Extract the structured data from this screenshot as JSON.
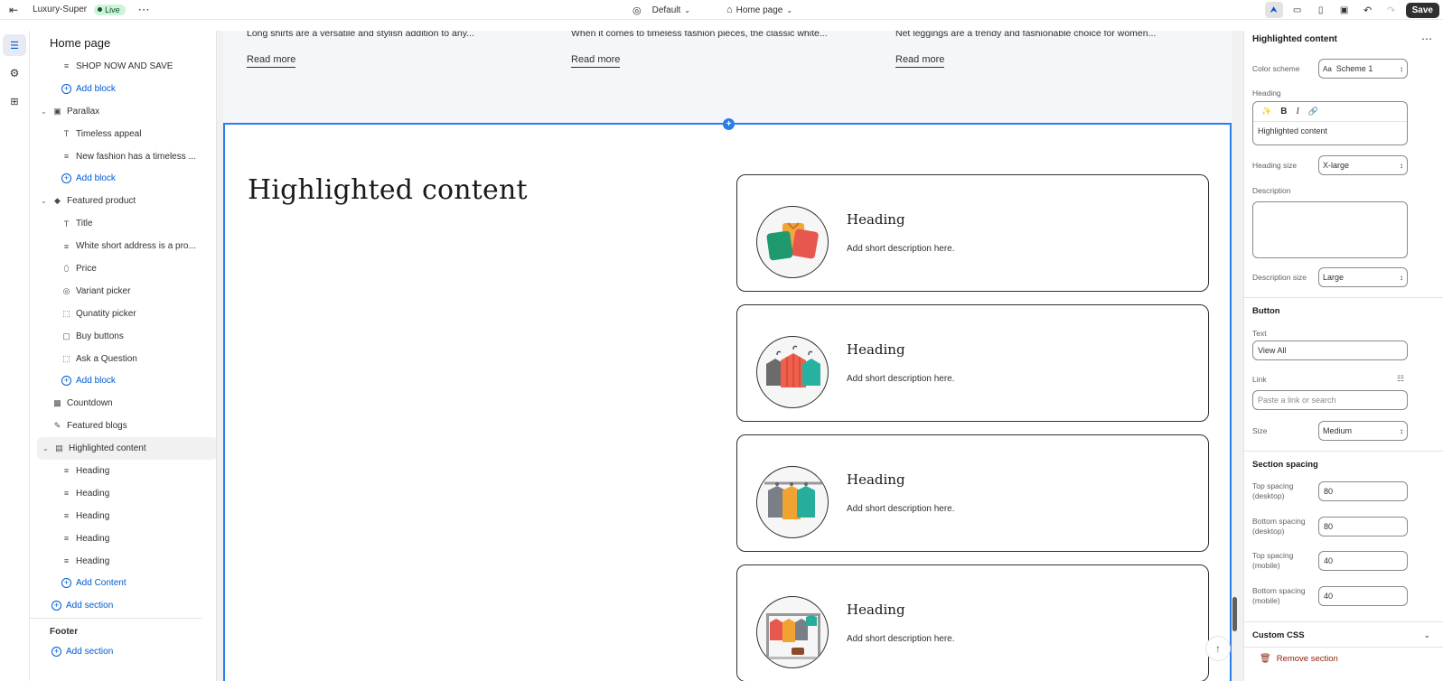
{
  "topbar": {
    "store_name": "Luxury-Super",
    "live_badge": "Live",
    "more": "⋯",
    "theme": "Default",
    "page": "Home page",
    "save": "Save"
  },
  "left_panel": {
    "title": "Home page",
    "rows": [
      {
        "label": "SHOP NOW AND SAVE",
        "kind": "block",
        "icon": "text-lines-icon"
      },
      {
        "label": "Add block",
        "kind": "add"
      },
      {
        "label": "Parallax",
        "kind": "section",
        "icon": "image-section-icon"
      },
      {
        "label": "Timeless appeal",
        "kind": "block",
        "icon": "text-T-icon"
      },
      {
        "label": "New fashion has a timeless ...",
        "kind": "block",
        "icon": "text-lines-icon"
      },
      {
        "label": "Add block",
        "kind": "add"
      },
      {
        "label": "Featured product",
        "kind": "section",
        "icon": "product-icon"
      },
      {
        "label": "Title",
        "kind": "block",
        "icon": "text-T-icon"
      },
      {
        "label": "White short address is a pro...",
        "kind": "block",
        "icon": "text-lines-icon"
      },
      {
        "label": "Price",
        "kind": "block",
        "icon": "price-tag-icon"
      },
      {
        "label": "Variant picker",
        "kind": "block",
        "icon": "variant-icon"
      },
      {
        "label": "Qunatity picker",
        "kind": "block",
        "icon": "dashed-square-icon"
      },
      {
        "label": "Buy buttons",
        "kind": "block",
        "icon": "cursor-button-icon"
      },
      {
        "label": "Ask a Question",
        "kind": "block",
        "icon": "dashed-square-icon"
      },
      {
        "label": "Add block",
        "kind": "add"
      },
      {
        "label": "Countdown",
        "kind": "section-noexp",
        "icon": "countdown-icon"
      },
      {
        "label": "Featured blogs",
        "kind": "section-noexp",
        "icon": "blog-edit-icon"
      },
      {
        "label": "Highlighted content",
        "kind": "section-selected",
        "icon": "content-icon"
      },
      {
        "label": "Heading",
        "kind": "block",
        "icon": "text-lines-icon"
      },
      {
        "label": "Heading",
        "kind": "block",
        "icon": "text-lines-icon"
      },
      {
        "label": "Heading",
        "kind": "block",
        "icon": "text-lines-icon"
      },
      {
        "label": "Heading",
        "kind": "block",
        "icon": "text-lines-icon"
      },
      {
        "label": "Heading",
        "kind": "block",
        "icon": "text-lines-icon"
      },
      {
        "label": "Add Content",
        "kind": "add"
      },
      {
        "label": "Add section",
        "kind": "add-section"
      }
    ],
    "footer_title": "Footer",
    "footer_add": "Add section"
  },
  "preview": {
    "blogs": [
      {
        "excerpt": "Long shirts are a versatile and stylish addition to any...",
        "link": "Read more"
      },
      {
        "excerpt": "When it comes to timeless fashion pieces, the classic white...",
        "link": "Read more"
      },
      {
        "excerpt": "Net leggings are a trendy and fashionable choice for women...",
        "link": "Read more"
      }
    ],
    "section_title": "Highlighted content",
    "cards": [
      {
        "heading": "Heading",
        "description": "Add short description here.",
        "image": "folded-shirts-icon"
      },
      {
        "heading": "Heading",
        "description": "Add short description here.",
        "image": "hanging-shirts-icon"
      },
      {
        "heading": "Heading",
        "description": "Add short description here.",
        "image": "jackets-on-rack-icon"
      },
      {
        "heading": "Heading",
        "description": "Add short description here.",
        "image": "clothes-rack-icon"
      }
    ]
  },
  "settings": {
    "title": "Highlighted content",
    "color_scheme_label": "Color scheme",
    "color_scheme_value": "Scheme 1",
    "heading_label": "Heading",
    "heading_value": "Highlighted content",
    "heading_size_label": "Heading size",
    "heading_size_value": "X-large",
    "description_label": "Description",
    "description_size_label": "Description size",
    "description_size_value": "Large",
    "button_section": "Button",
    "text_label": "Text",
    "text_value": "View All",
    "link_label": "Link",
    "link_placeholder": "Paste a link or search",
    "size_label": "Size",
    "size_value": "Medium",
    "spacing_section": "Section spacing",
    "top_desktop_label": "Top spacing (desktop)",
    "top_desktop_value": "80",
    "bottom_desktop_label": "Bottom spacing (desktop)",
    "bottom_desktop_value": "80",
    "top_mobile_label": "Top spacing (mobile)",
    "top_mobile_value": "40",
    "bottom_mobile_label": "Bottom spacing (mobile)",
    "bottom_mobile_value": "40",
    "custom_css": "Custom CSS",
    "remove_section": "Remove section"
  },
  "colors": {
    "accent": "#005bd3",
    "selection": "#2b7de9",
    "live_bg": "#cdf3d9",
    "danger": "#8e1f0b"
  }
}
